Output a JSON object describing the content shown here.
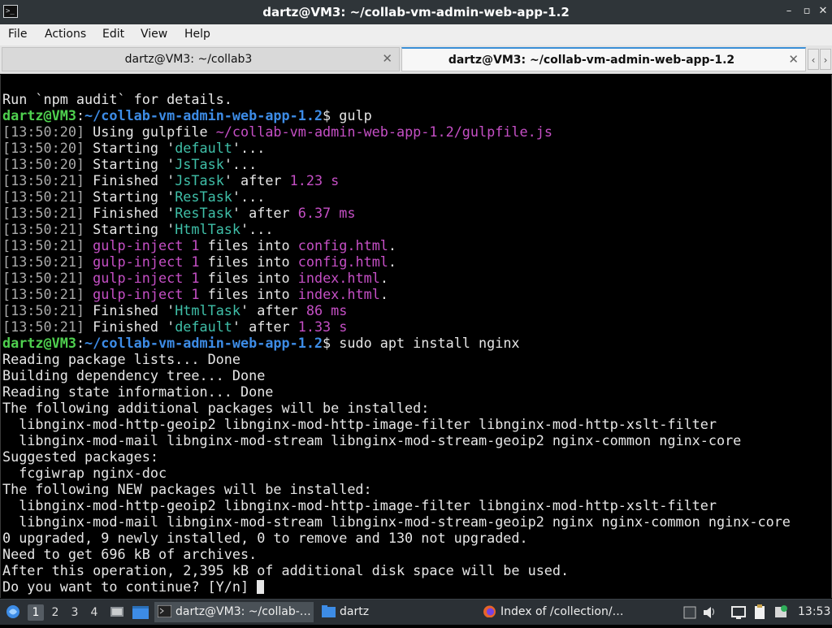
{
  "window": {
    "title": "dartz@VM3: ~/collab-vm-admin-web-app-1.2",
    "app_icon": ">_",
    "minimize_glyph": "–",
    "maximize_glyph": "▫",
    "close_glyph": "✕"
  },
  "menu": [
    "File",
    "Actions",
    "Edit",
    "View",
    "Help"
  ],
  "tabs": [
    {
      "label": "dartz@VM3: ~/collab3",
      "close": "✕",
      "active": false
    },
    {
      "label": "dartz@VM3: ~/collab-vm-admin-web-app-1.2",
      "close": "✕",
      "active": true
    }
  ],
  "tab_scroll": {
    "left": "‹",
    "right": "›"
  },
  "terminal": {
    "colors": {
      "user": "#4fd14f",
      "path": "#3d8ce6",
      "cyan": "#3fbfa8",
      "magenta": "#c54fc5",
      "time": "#aaaaaa",
      "text": "#e6e6e6"
    },
    "lines": [
      [
        [
          "Run `npm audit` for details.",
          "def"
        ]
      ],
      [
        [
          "dartz@VM3",
          "user"
        ],
        [
          ":",
          "def"
        ],
        [
          "~/collab-vm-admin-web-app-1.2",
          "path"
        ],
        [
          "$ gulp",
          "def"
        ]
      ],
      [
        [
          "[",
          "time"
        ],
        [
          "13:50:20",
          "time"
        ],
        [
          "]",
          "time"
        ],
        [
          " Using gulpfile ",
          "def"
        ],
        [
          "~/collab-vm-admin-web-app-1.2/gulpfile.js",
          "mag"
        ]
      ],
      [
        [
          "[13:50:20]",
          "time"
        ],
        [
          " Starting '",
          "def"
        ],
        [
          "default",
          "cyan"
        ],
        [
          "'...",
          "def"
        ]
      ],
      [
        [
          "[13:50:20]",
          "time"
        ],
        [
          " Starting '",
          "def"
        ],
        [
          "JsTask",
          "cyan"
        ],
        [
          "'...",
          "def"
        ]
      ],
      [
        [
          "[13:50:21]",
          "time"
        ],
        [
          " Finished '",
          "def"
        ],
        [
          "JsTask",
          "cyan"
        ],
        [
          "' after ",
          "def"
        ],
        [
          "1.23 s",
          "mag"
        ]
      ],
      [
        [
          "[13:50:21]",
          "time"
        ],
        [
          " Starting '",
          "def"
        ],
        [
          "ResTask",
          "cyan"
        ],
        [
          "'...",
          "def"
        ]
      ],
      [
        [
          "[13:50:21]",
          "time"
        ],
        [
          " Finished '",
          "def"
        ],
        [
          "ResTask",
          "cyan"
        ],
        [
          "' after ",
          "def"
        ],
        [
          "6.37 ms",
          "mag"
        ]
      ],
      [
        [
          "[13:50:21]",
          "time"
        ],
        [
          " Starting '",
          "def"
        ],
        [
          "HtmlTask",
          "cyan"
        ],
        [
          "'...",
          "def"
        ]
      ],
      [
        [
          "[13:50:21]",
          "time"
        ],
        [
          " ",
          "def"
        ],
        [
          "gulp-inject",
          "mag"
        ],
        [
          " ",
          "def"
        ],
        [
          "1",
          "mag"
        ],
        [
          " files into ",
          "def"
        ],
        [
          "config.html",
          "mag"
        ],
        [
          ".",
          "def"
        ]
      ],
      [
        [
          "[13:50:21]",
          "time"
        ],
        [
          " ",
          "def"
        ],
        [
          "gulp-inject",
          "mag"
        ],
        [
          " ",
          "def"
        ],
        [
          "1",
          "mag"
        ],
        [
          " files into ",
          "def"
        ],
        [
          "config.html",
          "mag"
        ],
        [
          ".",
          "def"
        ]
      ],
      [
        [
          "[13:50:21]",
          "time"
        ],
        [
          " ",
          "def"
        ],
        [
          "gulp-inject",
          "mag"
        ],
        [
          " ",
          "def"
        ],
        [
          "1",
          "mag"
        ],
        [
          " files into ",
          "def"
        ],
        [
          "index.html",
          "mag"
        ],
        [
          ".",
          "def"
        ]
      ],
      [
        [
          "[13:50:21]",
          "time"
        ],
        [
          " ",
          "def"
        ],
        [
          "gulp-inject",
          "mag"
        ],
        [
          " ",
          "def"
        ],
        [
          "1",
          "mag"
        ],
        [
          " files into ",
          "def"
        ],
        [
          "index.html",
          "mag"
        ],
        [
          ".",
          "def"
        ]
      ],
      [
        [
          "[13:50:21]",
          "time"
        ],
        [
          " Finished '",
          "def"
        ],
        [
          "HtmlTask",
          "cyan"
        ],
        [
          "' after ",
          "def"
        ],
        [
          "86 ms",
          "mag"
        ]
      ],
      [
        [
          "[13:50:21]",
          "time"
        ],
        [
          " Finished '",
          "def"
        ],
        [
          "default",
          "cyan"
        ],
        [
          "' after ",
          "def"
        ],
        [
          "1.33 s",
          "mag"
        ]
      ],
      [
        [
          "dartz@VM3",
          "user"
        ],
        [
          ":",
          "def"
        ],
        [
          "~/collab-vm-admin-web-app-1.2",
          "path"
        ],
        [
          "$ sudo apt install nginx",
          "def"
        ]
      ],
      [
        [
          "Reading package lists... Done",
          "def"
        ]
      ],
      [
        [
          "Building dependency tree... Done",
          "def"
        ]
      ],
      [
        [
          "Reading state information... Done",
          "def"
        ]
      ],
      [
        [
          "The following additional packages will be installed:",
          "def"
        ]
      ],
      [
        [
          "  libnginx-mod-http-geoip2 libnginx-mod-http-image-filter libnginx-mod-http-xslt-filter",
          "def"
        ]
      ],
      [
        [
          "  libnginx-mod-mail libnginx-mod-stream libnginx-mod-stream-geoip2 nginx-common nginx-core",
          "def"
        ]
      ],
      [
        [
          "Suggested packages:",
          "def"
        ]
      ],
      [
        [
          "  fcgiwrap nginx-doc",
          "def"
        ]
      ],
      [
        [
          "The following NEW packages will be installed:",
          "def"
        ]
      ],
      [
        [
          "  libnginx-mod-http-geoip2 libnginx-mod-http-image-filter libnginx-mod-http-xslt-filter",
          "def"
        ]
      ],
      [
        [
          "  libnginx-mod-mail libnginx-mod-stream libnginx-mod-stream-geoip2 nginx nginx-common nginx-core",
          "def"
        ]
      ],
      [
        [
          "0 upgraded, 9 newly installed, 0 to remove and 130 not upgraded.",
          "def"
        ]
      ],
      [
        [
          "Need to get 696 kB of archives.",
          "def"
        ]
      ],
      [
        [
          "After this operation, 2,395 kB of additional disk space will be used.",
          "def"
        ]
      ],
      [
        [
          "Do you want to continue? [Y/n] ",
          "def"
        ]
      ]
    ]
  },
  "taskbar": {
    "workspaces": [
      "1",
      "2",
      "3",
      "4"
    ],
    "active_workspace": "1",
    "tasks": [
      {
        "label": "dartz@VM3: ~/collab-…",
        "icon": "terminal-icon",
        "active": true
      },
      {
        "label": "dartz",
        "icon": "folder-icon",
        "active": false
      },
      {
        "label": "Index of /collection/…",
        "icon": "firefox-icon",
        "active": false
      }
    ],
    "clock": "13:53"
  }
}
